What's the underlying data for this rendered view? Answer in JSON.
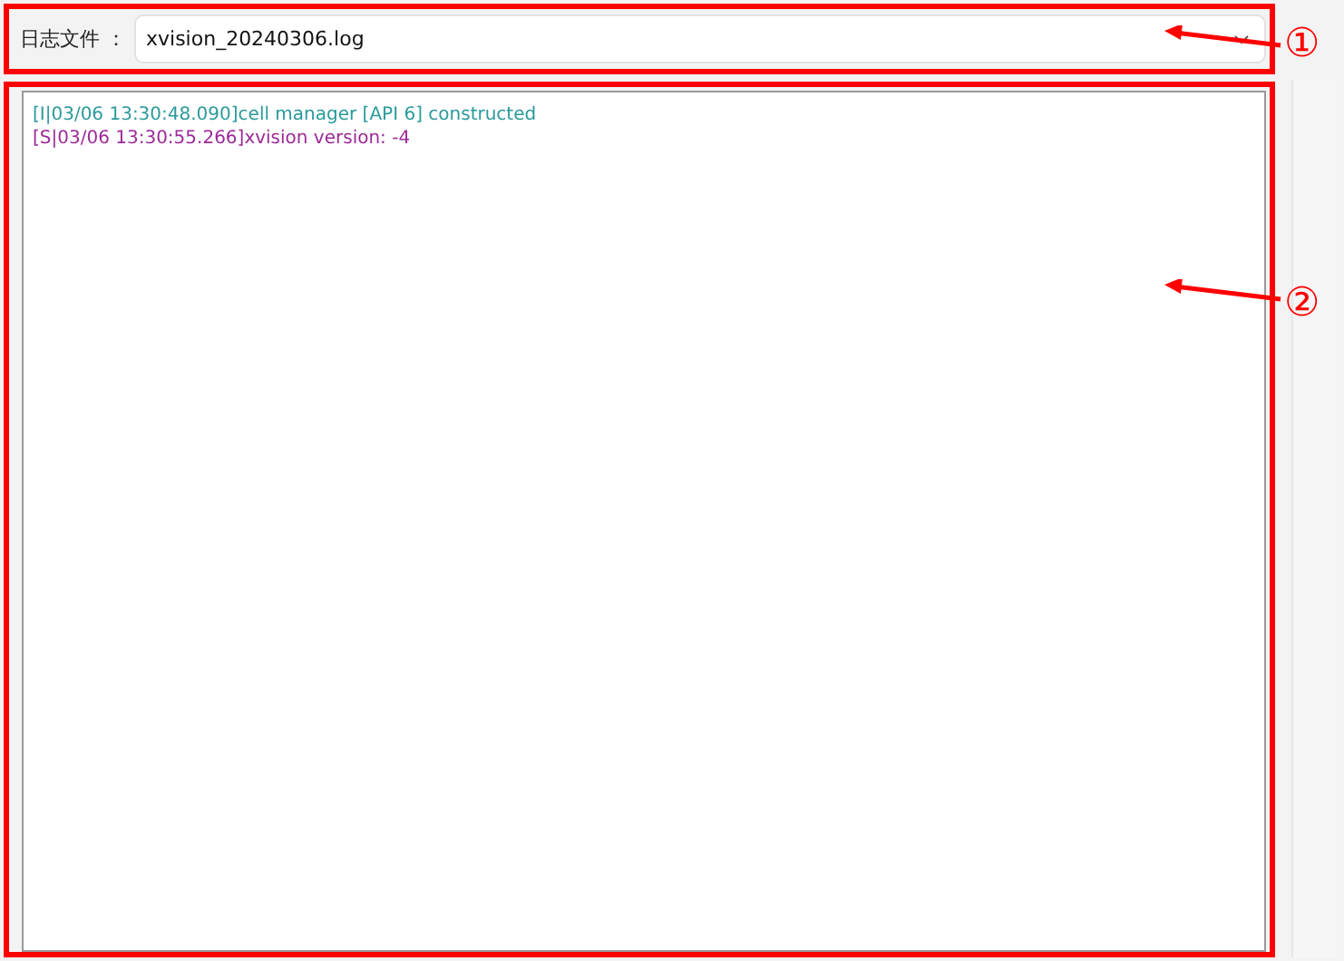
{
  "log_file": {
    "label": "日志文件 ：",
    "value": "xvision_20240306.log"
  },
  "log_lines": [
    {
      "kind": "info",
      "text": "[I|03/06 13:30:48.090]cell manager [API 6] constructed"
    },
    {
      "kind": "system",
      "text": "[S|03/06 13:30:55.266]xvision version: -4"
    }
  ],
  "callouts": [
    "①",
    "②"
  ]
}
